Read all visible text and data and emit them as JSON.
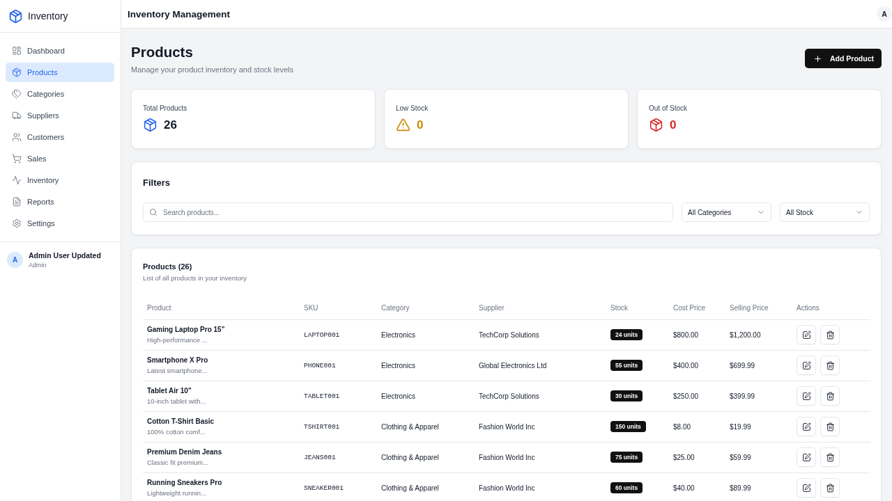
{
  "sidebar": {
    "brand": "Inventory",
    "items": [
      {
        "label": "Dashboard",
        "selected": false
      },
      {
        "label": "Products",
        "selected": true
      },
      {
        "label": "Categories",
        "selected": false
      },
      {
        "label": "Suppliers",
        "selected": false
      },
      {
        "label": "Customers",
        "selected": false
      },
      {
        "label": "Sales",
        "selected": false
      },
      {
        "label": "Inventory",
        "selected": false
      },
      {
        "label": "Reports",
        "selected": false
      },
      {
        "label": "Settings",
        "selected": false
      }
    ],
    "user": {
      "avatar": "A",
      "name": "Admin User Updated",
      "role": "Admin"
    }
  },
  "header": {
    "title": "Inventory Management",
    "avatar": "A"
  },
  "page": {
    "title": "Products",
    "subtitle": "Manage your product inventory and stock levels",
    "add_button": "Add Product"
  },
  "stats": [
    {
      "kind": "total",
      "label": "Total Products",
      "value": "26"
    },
    {
      "kind": "low",
      "label": "Low Stock",
      "value": "0"
    },
    {
      "kind": "out",
      "label": "Out of Stock",
      "value": "0"
    }
  ],
  "filters": {
    "title": "Filters",
    "search": {
      "placeholder": "Search products..."
    },
    "selects": [
      "All Categories",
      "All Stock"
    ]
  },
  "table": {
    "title": "Products (26)",
    "subtitle": "List of all products in your inventory",
    "columns": [
      "Product",
      "SKU",
      "Category",
      "Supplier",
      "Stock",
      "Cost Price",
      "Selling Price",
      "Actions"
    ],
    "rows": [
      {
        "name": "Gaming Laptop Pro 15\"",
        "description": "High-performance ...",
        "sku": "LAPTOP001",
        "category": "Electronics",
        "supplier": "TechCorp Solutions",
        "stock": "24 units",
        "cost_price": "$800.00",
        "selling_price": "$1,200.00"
      },
      {
        "name": "Smartphone X Pro",
        "description": "Latest smartphone...",
        "sku": "PHONE001",
        "category": "Electronics",
        "supplier": "Global Electronics Ltd",
        "stock": "55 units",
        "cost_price": "$400.00",
        "selling_price": "$699.99"
      },
      {
        "name": "Tablet Air 10\"",
        "description": "10-inch tablet with...",
        "sku": "TABLET001",
        "category": "Electronics",
        "supplier": "TechCorp Solutions",
        "stock": "30 units",
        "cost_price": "$250.00",
        "selling_price": "$399.99"
      },
      {
        "name": "Cotton T-Shirt Basic",
        "description": "100% cotton comf...",
        "sku": "TSHIRT001",
        "category": "Clothing & Apparel",
        "supplier": "Fashion World Inc",
        "stock": "150 units",
        "cost_price": "$8.00",
        "selling_price": "$19.99"
      },
      {
        "name": "Premium Denim Jeans",
        "description": "Classic fit premium...",
        "sku": "JEANS001",
        "category": "Clothing & Apparel",
        "supplier": "Fashion World Inc",
        "stock": "75 units",
        "cost_price": "$25.00",
        "selling_price": "$59.99"
      },
      {
        "name": "Running Sneakers Pro",
        "description": "Lightweight runnin...",
        "sku": "SNEAKER001",
        "category": "Clothing & Apparel",
        "supplier": "Fashion World Inc",
        "stock": "60 units",
        "cost_price": "$40.00",
        "selling_price": "$89.99"
      }
    ]
  }
}
